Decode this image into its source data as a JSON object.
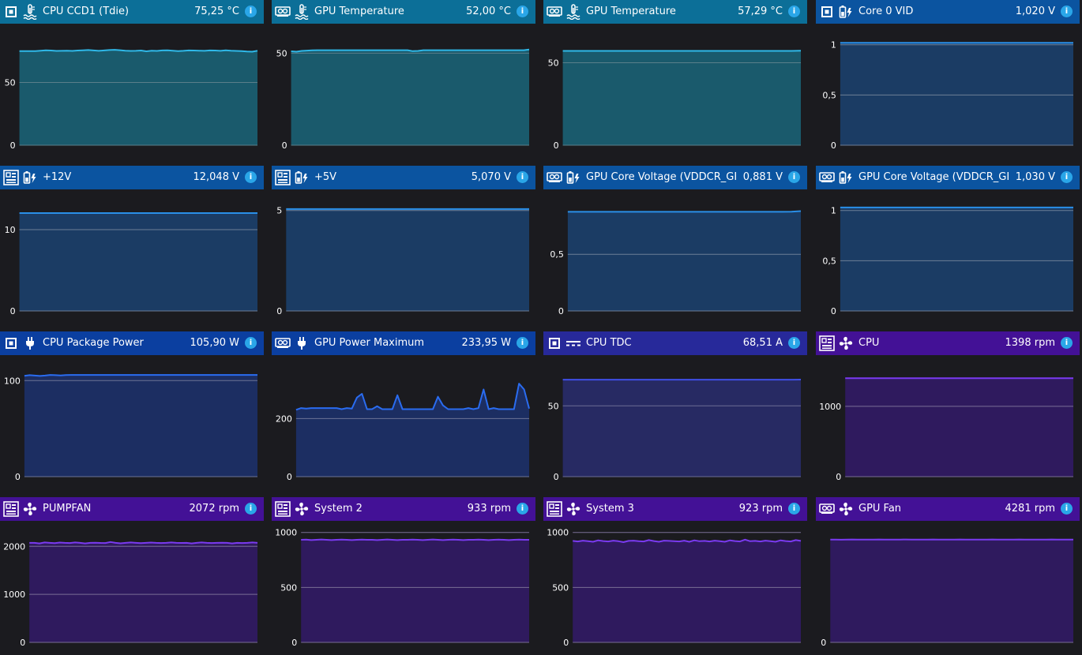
{
  "panels": [
    {
      "name": "CPU CCD1 (Tdie)",
      "value": "75,25 °C",
      "source_icon": "cpu-chip-icon",
      "type_icon": "thermometer-icon",
      "theme": "teal",
      "ticks": [
        {
          "v": 0,
          "label": "0"
        },
        {
          "v": 50,
          "label": "50"
        }
      ],
      "ymax": 88,
      "series": [
        75,
        75,
        75,
        75,
        75.3,
        75.6,
        75.4,
        75.1,
        75.2,
        75.3,
        75.1,
        75.4,
        75.6,
        75.8,
        75.5,
        75.2,
        75.5,
        75.8,
        76,
        75.7,
        75.3,
        75.1,
        75.2,
        75.4,
        74.8,
        75.3,
        75.1,
        75.5,
        75.6,
        75.3,
        75,
        75.2,
        75.5,
        75.4,
        75.3,
        75.2,
        75.5,
        75.4,
        75.2,
        75.6,
        75.3,
        75.1,
        75,
        74.6,
        74.5,
        75.25
      ]
    },
    {
      "name": "GPU Temperature",
      "value": "52,00 °C",
      "source_icon": "motherboard-gpu-icon",
      "type_icon": "thermometer-icon",
      "theme": "teal",
      "ticks": [
        {
          "v": 0,
          "label": "0"
        },
        {
          "v": 50,
          "label": "50"
        }
      ],
      "ymax": 60,
      "series": [
        51,
        50.8,
        51.2,
        51.4,
        51.5,
        51.6,
        51.6,
        51.6,
        51.6,
        51.6,
        51.6,
        51.6,
        51.6,
        51.6,
        51.6,
        51.6,
        51.6,
        51.6,
        51.6,
        51.6,
        51.6,
        51.6,
        51.6,
        51.1,
        51.2,
        51.6,
        51.6,
        51.6,
        51.6,
        51.6,
        51.6,
        51.6,
        51.6,
        51.6,
        51.6,
        51.6,
        51.6,
        51.6,
        51.6,
        51.6,
        51.6,
        51.6,
        51.6,
        51.6,
        51.6,
        52
      ]
    },
    {
      "name": "GPU Temperature",
      "value": "57,29 °C",
      "source_icon": "graphics-card-icon",
      "type_icon": "thermometer-icon",
      "theme": "teal",
      "ticks": [
        {
          "v": 0,
          "label": "0"
        },
        {
          "v": 50,
          "label": "50"
        }
      ],
      "ymax": 67,
      "series": [
        57.2,
        57.2,
        57.2,
        57.2,
        57.2,
        57.2,
        57.2,
        57.2,
        57.2,
        57.2,
        57.2,
        57.2,
        57.2,
        57.2,
        57.2,
        57.2,
        57.2,
        57.2,
        57.2,
        57.2,
        57.2,
        57.2,
        57.2,
        57.2,
        57.2,
        57.29
      ]
    },
    {
      "name": "Core 0 VID",
      "value": "1,020 V",
      "source_icon": "cpu-chip-icon",
      "type_icon": "battery-bolt-icon",
      "theme": "blue",
      "ticks": [
        {
          "v": 0,
          "label": "0"
        },
        {
          "v": 0.5,
          "label": "0,5"
        },
        {
          "v": 1,
          "label": "1"
        }
      ],
      "ymax": 1.1,
      "series": [
        1.02,
        1.02,
        1.02,
        1.02,
        1.02,
        1.02,
        1.02,
        1.02,
        1.02,
        1.02,
        1.02,
        1.02,
        1.02,
        1.02,
        1.02,
        1.02,
        1.02,
        1.02,
        1.02,
        1.02
      ]
    },
    {
      "name": "+12V",
      "value": "12,048 V",
      "source_icon": "motherboard-icon",
      "type_icon": "battery-bolt-icon",
      "theme": "blue",
      "ticks": [
        {
          "v": 0,
          "label": "0"
        },
        {
          "v": 10,
          "label": "10"
        }
      ],
      "ymax": 13.6,
      "series": [
        12.048,
        12.048,
        12.048,
        12.048,
        12.048,
        12.048,
        12.048,
        12.048,
        12.048,
        12.048,
        12.048,
        12.048,
        12.048,
        12.048,
        12.048,
        12.048
      ]
    },
    {
      "name": "+5V",
      "value": "5,070 V",
      "source_icon": "motherboard-icon",
      "type_icon": "battery-bolt-icon",
      "theme": "blue",
      "ticks": [
        {
          "v": 0,
          "label": "0"
        },
        {
          "v": 5,
          "label": "5"
        }
      ],
      "ymax": 5.5,
      "series": [
        5.07,
        5.07,
        5.07,
        5.07,
        5.07,
        5.07,
        5.07,
        5.07,
        5.07,
        5.07,
        5.07,
        5.07,
        5.07,
        5.07,
        5.07,
        5.07
      ]
    },
    {
      "name": "GPU Core Voltage (VDDCR_GFX)",
      "value": "0,881 V",
      "source_icon": "graphics-card-icon",
      "type_icon": "battery-bolt-icon",
      "theme": "blue",
      "ticks": [
        {
          "v": 0,
          "label": "0"
        },
        {
          "v": 0.5,
          "label": "0,5"
        }
      ],
      "ymax": 0.975,
      "series": [
        0.875,
        0.875,
        0.875,
        0.875,
        0.875,
        0.875,
        0.875,
        0.875,
        0.875,
        0.875,
        0.875,
        0.875,
        0.875,
        0.875,
        0.875,
        0.875,
        0.875,
        0.875,
        0.875,
        0.875,
        0.875,
        0.875,
        0.875,
        0.875,
        0.876,
        0.881
      ]
    },
    {
      "name": "GPU Core Voltage (VDDCR_GFX)",
      "value": "1,030 V",
      "source_icon": "graphics-card-icon",
      "type_icon": "battery-bolt-icon",
      "theme": "blue",
      "ticks": [
        {
          "v": 0,
          "label": "0"
        },
        {
          "v": 0.5,
          "label": "0,5"
        },
        {
          "v": 1,
          "label": "1"
        }
      ],
      "ymax": 1.1,
      "series": [
        1.03,
        1.03,
        1.03,
        1.03,
        1.03,
        1.03,
        1.03,
        1.03,
        1.03,
        1.03,
        1.03,
        1.03,
        1.03,
        1.03,
        1.03,
        1.03
      ]
    },
    {
      "name": "CPU Package Power",
      "value": "105,90 W",
      "source_icon": "cpu-chip-icon",
      "type_icon": "power-plug-icon",
      "theme": "navy",
      "ticks": [
        {
          "v": 0,
          "label": "0"
        },
        {
          "v": 100,
          "label": "100"
        }
      ],
      "ymax": 115,
      "series": [
        105,
        105.6,
        105.2,
        104.8,
        105.2,
        105.9,
        105.6,
        105.4,
        105.8,
        105.9,
        105.9,
        105.9,
        105.9,
        105.9,
        105.9,
        105.9,
        105.9,
        105.9,
        105.9,
        105.9,
        105.9,
        105.9,
        105.9,
        105.9,
        105.9,
        105.9,
        105.9,
        105.9,
        105.9,
        105.9,
        105.9,
        105.9,
        105.9,
        105.9,
        105.9,
        105.9,
        105.9,
        105.9,
        105.9,
        105.9,
        105.9,
        105.9,
        105.9,
        105.9,
        105.9,
        105.9
      ]
    },
    {
      "name": "GPU Power Maximum",
      "value": "233,95 W",
      "source_icon": "graphics-card-icon",
      "type_icon": "power-plug-icon",
      "theme": "navy",
      "ticks": [
        {
          "v": 0,
          "label": "0"
        },
        {
          "v": 200,
          "label": "200"
        }
      ],
      "ymax": 380,
      "series": [
        230,
        236,
        234,
        236,
        236,
        236,
        236,
        236,
        236,
        232,
        236,
        234,
        272,
        285,
        232,
        232,
        242,
        232,
        232,
        232,
        280,
        232,
        232,
        232,
        232,
        232,
        232,
        232,
        275,
        245,
        232,
        232,
        232,
        232,
        236,
        232,
        236,
        300,
        232,
        236,
        232,
        232,
        232,
        232,
        320,
        300,
        233.95
      ]
    },
    {
      "name": "CPU TDC",
      "value": "68,51 A",
      "source_icon": "cpu-chip-icon",
      "type_icon": "current-icon",
      "theme": "indigo",
      "ticks": [
        {
          "v": 0,
          "label": "0"
        },
        {
          "v": 50,
          "label": "50"
        }
      ],
      "ymax": 78,
      "series": [
        68.5,
        68.5,
        68.5,
        68.5,
        68.5,
        68.5,
        68.5,
        68.5,
        68.5,
        68.5,
        68.5,
        68.5,
        68.5,
        68.5,
        68.5,
        68.5,
        68.5,
        68.5,
        68.5,
        68.5,
        68.5,
        68.5,
        68.5,
        68.5,
        68.5,
        68.5,
        68.5,
        68.5,
        68.5,
        68.51
      ]
    },
    {
      "name": "CPU",
      "value": "1398 rpm",
      "source_icon": "motherboard-icon",
      "type_icon": "fan-icon",
      "theme": "purple",
      "ticks": [
        {
          "v": 0,
          "label": "0"
        },
        {
          "v": 1000,
          "label": "1000"
        }
      ],
      "ymax": 1570,
      "series": [
        1398,
        1398,
        1398,
        1398,
        1398,
        1398,
        1398,
        1398,
        1398,
        1398,
        1398,
        1398,
        1398,
        1398,
        1398,
        1398,
        1398,
        1398,
        1398,
        1398,
        1398,
        1398,
        1398,
        1398,
        1398,
        1398
      ]
    },
    {
      "name": "PUMPFAN",
      "value": "2072 rpm",
      "source_icon": "motherboard-icon",
      "type_icon": "fan-icon",
      "theme": "purple",
      "ticks": [
        {
          "v": 0,
          "label": "0"
        },
        {
          "v": 1000,
          "label": "1000"
        },
        {
          "v": 2000,
          "label": "2000"
        }
      ],
      "ymax": 2300,
      "series": [
        2072,
        2072,
        2060,
        2080,
        2072,
        2065,
        2078,
        2072,
        2068,
        2080,
        2072,
        2060,
        2072,
        2075,
        2070,
        2068,
        2090,
        2072,
        2062,
        2072,
        2080,
        2072,
        2065,
        2072,
        2078,
        2072,
        2068,
        2072,
        2080,
        2072,
        2070,
        2072,
        2060,
        2072,
        2080,
        2072,
        2068,
        2072,
        2075,
        2072,
        2060,
        2072,
        2068,
        2072,
        2080,
        2072
      ]
    },
    {
      "name": "System 2",
      "value": "933 rpm",
      "source_icon": "motherboard-icon",
      "type_icon": "fan-icon",
      "theme": "purple",
      "ticks": [
        {
          "v": 0,
          "label": "0"
        },
        {
          "v": 500,
          "label": "500"
        },
        {
          "v": 1000,
          "label": "1000"
        }
      ],
      "ymax": 1005,
      "series": [
        933,
        935,
        930,
        933,
        936,
        933,
        930,
        933,
        935,
        933,
        930,
        933,
        935,
        933,
        933,
        930,
        933,
        936,
        933,
        930,
        933,
        933,
        935,
        933,
        930,
        933,
        936,
        933,
        930,
        933,
        935,
        933,
        930,
        933,
        933,
        935,
        933,
        930,
        933,
        935,
        933,
        930,
        933,
        935,
        933,
        933
      ]
    },
    {
      "name": "System 3",
      "value": "923 rpm",
      "source_icon": "motherboard-icon",
      "type_icon": "fan-icon",
      "theme": "purple",
      "ticks": [
        {
          "v": 0,
          "label": "0"
        },
        {
          "v": 500,
          "label": "500"
        },
        {
          "v": 1000,
          "label": "1000"
        }
      ],
      "ymax": 1005,
      "series": [
        923,
        918,
        925,
        920,
        915,
        928,
        922,
        918,
        925,
        920,
        912,
        923,
        925,
        920,
        918,
        930,
        922,
        915,
        925,
        923,
        920,
        918,
        925,
        915,
        928,
        920,
        923,
        918,
        925,
        920,
        915,
        928,
        922,
        918,
        935,
        920,
        923,
        918,
        925,
        920,
        915,
        928,
        922,
        918,
        930,
        923
      ]
    },
    {
      "name": "GPU Fan",
      "value": "4281 rpm",
      "source_icon": "graphics-card-icon",
      "type_icon": "fan-icon",
      "theme": "purple",
      "ticks": [
        {
          "v": 0,
          "label": "0"
        }
      ],
      "ymax": 4600,
      "series": [
        4281,
        4281,
        4275,
        4281,
        4285,
        4281,
        4278,
        4281,
        4281,
        4283,
        4281,
        4278,
        4281,
        4281,
        4285,
        4281,
        4278,
        4281,
        4281,
        4283,
        4281,
        4281,
        4278,
        4281,
        4285,
        4281,
        4281,
        4278,
        4281,
        4281,
        4283,
        4281,
        4281,
        4278,
        4281,
        4285,
        4281,
        4281,
        4278,
        4281,
        4281,
        4283,
        4281,
        4281,
        4278,
        4281
      ]
    }
  ],
  "themes": {
    "teal": {
      "header": "#0c6f98",
      "line": "#2fb8e8",
      "fill": "#1a5a6c",
      "grid": "#5a7f8a"
    },
    "blue": {
      "header": "#0b54a0",
      "line": "#2a8fe8",
      "fill": "#1b3c64",
      "grid": "#6d7e96"
    },
    "navy": {
      "header": "#0b3fa0",
      "line": "#2a6cf0",
      "fill": "#1c2e62",
      "grid": "#6b7496"
    },
    "indigo": {
      "header": "#27299a",
      "line": "#3f4fe6",
      "fill": "#272a63",
      "grid": "#6b6d94"
    },
    "purple": {
      "header": "#431196",
      "line": "#7a3af0",
      "fill": "#2f1a5e",
      "grid": "#7a6e96"
    }
  }
}
